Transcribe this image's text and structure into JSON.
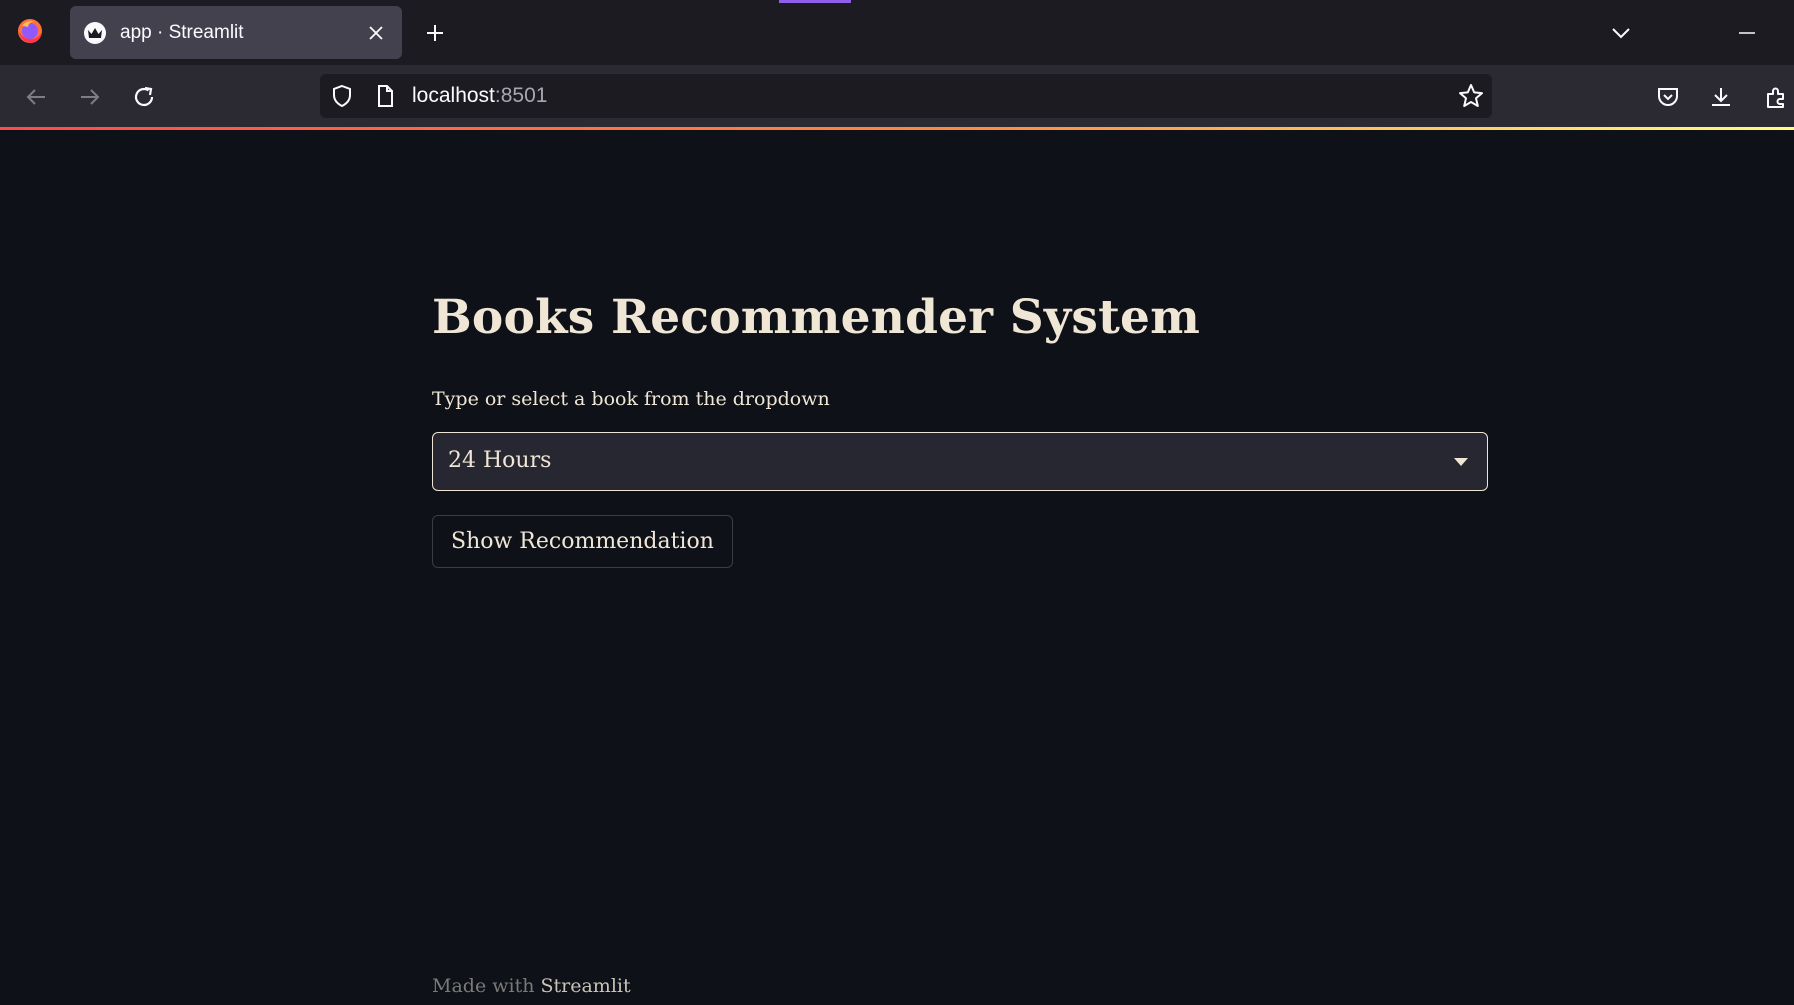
{
  "browser": {
    "tab": {
      "title": "app · Streamlit"
    },
    "urlbar": {
      "host": "localhost",
      "port": ":8501"
    },
    "icons": {
      "logo": "firefox-logo-icon",
      "favicon": "streamlit-crown-icon",
      "close": "close-icon",
      "new_tab": "plus-icon",
      "list_tabs": "chevron-down-icon",
      "minimize": "minimize-icon",
      "back": "back-arrow-icon",
      "forward": "forward-arrow-icon",
      "reload": "reload-icon",
      "shield": "shield-icon",
      "page": "page-icon",
      "bookmark": "star-icon",
      "pocket": "pocket-icon",
      "downloads": "download-icon",
      "extensions": "puzzle-icon"
    },
    "colors": {
      "tabstrip": "#1c1b22",
      "navbar": "#2b2a33",
      "accent_purple": "#8f5fe8"
    }
  },
  "app": {
    "title": "Books Recommender System",
    "select": {
      "label": "Type or select a book from the dropdown",
      "value": "24 Hours"
    },
    "button_label": "Show Recommendation",
    "footer": {
      "prefix": "Made with",
      "link": "Streamlit"
    },
    "colors": {
      "background": "#0e1117",
      "text": "#f0e6d6",
      "select_bg": "#262730",
      "gradient_start": "#ff4b4b",
      "gradient_end": "#fffd80"
    }
  }
}
